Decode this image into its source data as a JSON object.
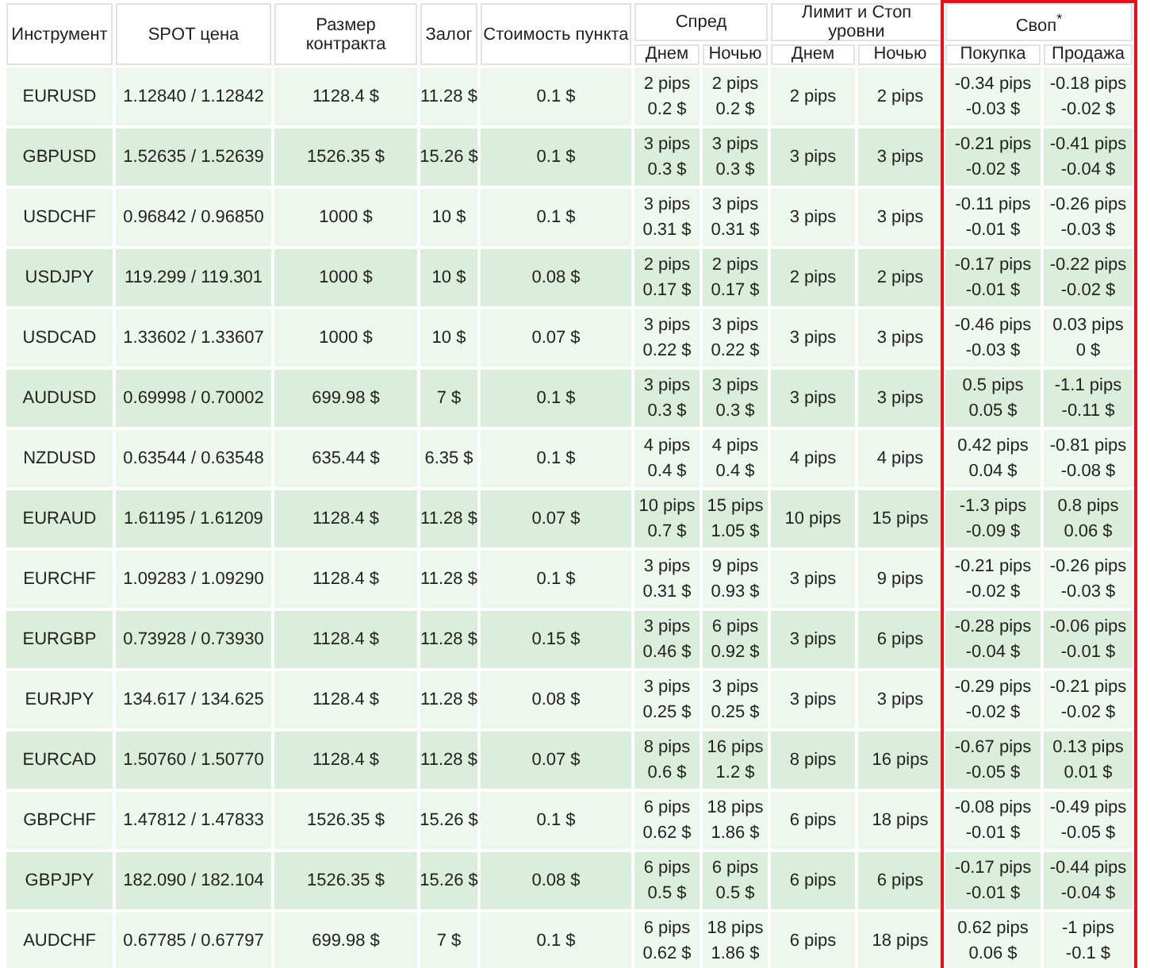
{
  "header": {
    "top": [
      "Инструмент",
      "SPOT цена",
      "Размер контракта",
      "Залог",
      "Стоимость пункта",
      "Спред",
      "Лимит и Стоп уровни",
      "Своп$^{*}$"
    ],
    "sub": [
      "Днем",
      "Ночью",
      "Днем",
      "Ночью",
      "Покупка",
      "Продажа"
    ]
  },
  "rows": [
    [
      "EURUSD",
      "1.12840 / 1.12842",
      "1128.4 $",
      "11.28 $",
      "0.1 $",
      [
        "2 pips",
        "0.2 $"
      ],
      [
        "2 pips",
        "0.2 $"
      ],
      "2 pips",
      "2 pips",
      [
        "-0.34 pips",
        "-0.03 $"
      ],
      [
        "-0.18 pips",
        "-0.02 $"
      ]
    ],
    [
      "GBPUSD",
      "1.52635 / 1.52639",
      "1526.35 $",
      "15.26 $",
      "0.1 $",
      [
        "3 pips",
        "0.3 $"
      ],
      [
        "3 pips",
        "0.3 $"
      ],
      "3 pips",
      "3 pips",
      [
        "-0.21 pips",
        "-0.02 $"
      ],
      [
        "-0.41 pips",
        "-0.04 $"
      ]
    ],
    [
      "USDCHF",
      "0.96842 / 0.96850",
      "1000 $",
      "10 $",
      "0.1 $",
      [
        "3 pips",
        "0.31 $"
      ],
      [
        "3 pips",
        "0.31 $"
      ],
      "3 pips",
      "3 pips",
      [
        "-0.11 pips",
        "-0.01 $"
      ],
      [
        "-0.26 pips",
        "-0.03 $"
      ]
    ],
    [
      "USDJPY",
      "119.299 / 119.301",
      "1000 $",
      "10 $",
      "0.08 $",
      [
        "2 pips",
        "0.17 $"
      ],
      [
        "2 pips",
        "0.17 $"
      ],
      "2 pips",
      "2 pips",
      [
        "-0.17 pips",
        "-0.01 $"
      ],
      [
        "-0.22 pips",
        "-0.02 $"
      ]
    ],
    [
      "USDCAD",
      "1.33602 / 1.33607",
      "1000 $",
      "10 $",
      "0.07 $",
      [
        "3 pips",
        "0.22 $"
      ],
      [
        "3 pips",
        "0.22 $"
      ],
      "3 pips",
      "3 pips",
      [
        "-0.46 pips",
        "-0.03 $"
      ],
      [
        "0.03 pips",
        "0 $"
      ]
    ],
    [
      "AUDUSD",
      "0.69998 / 0.70002",
      "699.98 $",
      "7 $",
      "0.1 $",
      [
        "3 pips",
        "0.3 $"
      ],
      [
        "3 pips",
        "0.3 $"
      ],
      "3 pips",
      "3 pips",
      [
        "0.5 pips",
        "0.05 $"
      ],
      [
        "-1.1 pips",
        "-0.11 $"
      ]
    ],
    [
      "NZDUSD",
      "0.63544 / 0.63548",
      "635.44 $",
      "6.35 $",
      "0.1 $",
      [
        "4 pips",
        "0.4 $"
      ],
      [
        "4 pips",
        "0.4 $"
      ],
      "4 pips",
      "4 pips",
      [
        "0.42 pips",
        "0.04 $"
      ],
      [
        "-0.81 pips",
        "-0.08 $"
      ]
    ],
    [
      "EURAUD",
      "1.61195 / 1.61209",
      "1128.4 $",
      "11.28 $",
      "0.07 $",
      [
        "10 pips",
        "0.7 $"
      ],
      [
        "15 pips",
        "1.05 $"
      ],
      "10 pips",
      "15 pips",
      [
        "-1.3 pips",
        "-0.09 $"
      ],
      [
        "0.8 pips",
        "0.06 $"
      ]
    ],
    [
      "EURCHF",
      "1.09283 / 1.09290",
      "1128.4 $",
      "11.28 $",
      "0.1 $",
      [
        "3 pips",
        "0.31 $"
      ],
      [
        "9 pips",
        "0.93 $"
      ],
      "3 pips",
      "9 pips",
      [
        "-0.21 pips",
        "-0.02 $"
      ],
      [
        "-0.26 pips",
        "-0.03 $"
      ]
    ],
    [
      "EURGBP",
      "0.73928 / 0.73930",
      "1128.4 $",
      "11.28 $",
      "0.15 $",
      [
        "3 pips",
        "0.46 $"
      ],
      [
        "6 pips",
        "0.92 $"
      ],
      "3 pips",
      "6 pips",
      [
        "-0.28 pips",
        "-0.04 $"
      ],
      [
        "-0.06 pips",
        "-0.01 $"
      ]
    ],
    [
      "EURJPY",
      "134.617 / 134.625",
      "1128.4 $",
      "11.28 $",
      "0.08 $",
      [
        "3 pips",
        "0.25 $"
      ],
      [
        "3 pips",
        "0.25 $"
      ],
      "3 pips",
      "3 pips",
      [
        "-0.29 pips",
        "-0.02 $"
      ],
      [
        "-0.21 pips",
        "-0.02 $"
      ]
    ],
    [
      "EURCAD",
      "1.50760 / 1.50770",
      "1128.4 $",
      "11.28 $",
      "0.07 $",
      [
        "8 pips",
        "0.6 $"
      ],
      [
        "16 pips",
        "1.2 $"
      ],
      "8 pips",
      "16 pips",
      [
        "-0.67 pips",
        "-0.05 $"
      ],
      [
        "0.13 pips",
        "0.01 $"
      ]
    ],
    [
      "GBPCHF",
      "1.47812 / 1.47833",
      "1526.35 $",
      "15.26 $",
      "0.1 $",
      [
        "6 pips",
        "0.62 $"
      ],
      [
        "18 pips",
        "1.86 $"
      ],
      "6 pips",
      "18 pips",
      [
        "-0.08 pips",
        "-0.01 $"
      ],
      [
        "-0.49 pips",
        "-0.05 $"
      ]
    ],
    [
      "GBPJPY",
      "182.090 / 182.104",
      "1526.35 $",
      "15.26 $",
      "0.08 $",
      [
        "6 pips",
        "0.5 $"
      ],
      [
        "6 pips",
        "0.5 $"
      ],
      "6 pips",
      "6 pips",
      [
        "-0.17 pips",
        "-0.01 $"
      ],
      [
        "-0.44 pips",
        "-0.04 $"
      ]
    ],
    [
      "AUDCHF",
      "0.67785 / 0.67797",
      "699.98 $",
      "7 $",
      "0.1 $",
      [
        "6 pips",
        "0.62 $"
      ],
      [
        "18 pips",
        "1.86 $"
      ],
      "6 pips",
      "18 pips",
      [
        "0.62 pips",
        "0.06 $"
      ],
      [
        "-1 pips",
        "-0.1 $"
      ]
    ]
  ]
}
